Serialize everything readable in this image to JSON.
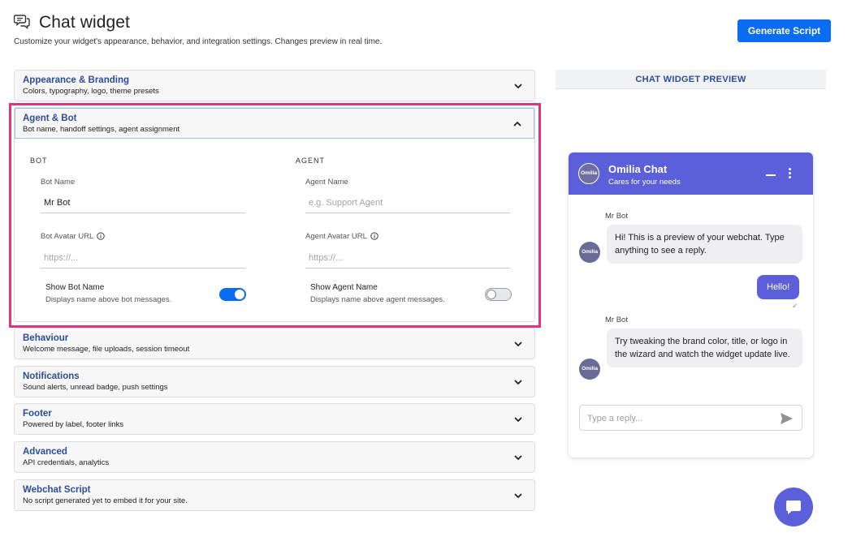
{
  "header": {
    "title": "Chat widget",
    "subtitle": "Customize your widget's appearance, behavior, and integration settings. Changes preview in real time.",
    "generate_label": "Generate Script"
  },
  "sections": [
    {
      "title": "Appearance & Branding",
      "desc": "Colors, typography, logo, theme presets"
    },
    {
      "title": "Agent & Bot",
      "desc": "Bot name, handoff settings, agent assignment",
      "expanded": true
    },
    {
      "title": "Behaviour",
      "desc": "Welcome message, file uploads, session timeout"
    },
    {
      "title": "Notifications",
      "desc": "Sound alerts, unread badge, push settings"
    },
    {
      "title": "Footer",
      "desc": "Powered by label, footer links"
    },
    {
      "title": "Advanced",
      "desc": "API credentials, analytics"
    },
    {
      "title": "Webchat Script",
      "desc": "No script generated yet to embed it for your site."
    }
  ],
  "agent_bot": {
    "bot": {
      "heading": "BOT",
      "name_label": "Bot Name",
      "name_value": "Mr Bot",
      "avatar_label": "Bot Avatar URL",
      "avatar_placeholder": "https://...",
      "toggle_label": "Show Bot Name",
      "toggle_desc": "Displays name above bot messages.",
      "toggle_on": true
    },
    "agent": {
      "heading": "AGENT",
      "name_label": "Agent Name",
      "name_placeholder": "e.g. Support Agent",
      "avatar_label": "Agent Avatar URL",
      "avatar_placeholder": "https://...",
      "toggle_label": "Show Agent Name",
      "toggle_desc": "Displays name above agent messages.",
      "toggle_on": false
    }
  },
  "preview": {
    "heading": "CHAT WIDGET PREVIEW",
    "widget_title": "Omilia Chat",
    "widget_subtitle": "Cares for your needs",
    "logo_text": "Omilia",
    "messages": [
      {
        "from": "bot",
        "sender": "Mr Bot",
        "text": "Hi! This is a preview of your webchat. Type anything to see a reply."
      },
      {
        "from": "user",
        "text": "Hello!"
      },
      {
        "from": "bot",
        "sender": "Mr Bot",
        "text": "Try tweaking the brand color, title, or logo in the wizard and watch the widget update live."
      }
    ],
    "check_mark": "✓",
    "reply_placeholder": "Type a reply..."
  },
  "colors": {
    "primary": "#0a6cf2",
    "widget_accent": "#5b5fd9",
    "section_title": "#2c4c9c",
    "highlight": "#e0357a"
  },
  "icons": [
    "chat-bubbles-icon",
    "chevron-down-icon",
    "chevron-up-icon",
    "info-icon",
    "minimize-icon",
    "more-vertical-icon",
    "send-icon",
    "chat-icon"
  ]
}
